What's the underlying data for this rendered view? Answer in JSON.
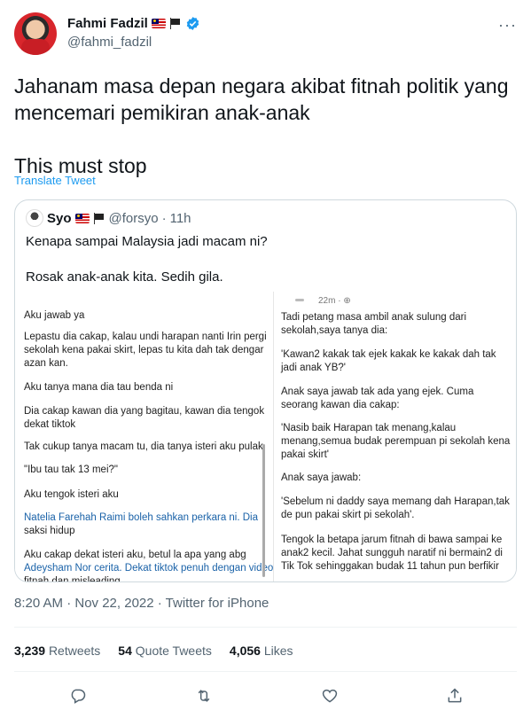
{
  "author": {
    "display_name": "Fahmi Fadzil",
    "handle": "@fahmi_fadzil"
  },
  "tweet": {
    "text": "Jahanam masa depan negara akibat fitnah politik yang mencemari pemikiran anak-anak\n\nThis must stop",
    "translate_label": "Translate Tweet",
    "timestamp": "8:20 AM · Nov 22, 2022 · Twitter for iPhone"
  },
  "quote": {
    "display_name": "Syo",
    "handle": "@forsyo",
    "time": "11h",
    "text": "Kenapa sampai Malaysia jadi macam ni?\n\nRosak anak-anak kita. Sedih gila.",
    "image_left_lines": [
      "Aku jawab ya",
      "Lepastu dia cakap, kalau undi harapan nanti Irin pergi",
      "sekolah kena pakai skirt, lepas tu kita dah tak dengar",
      "azan kan.",
      "Aku tanya mana dia tau benda ni",
      "Dia cakap kawan dia yang bagitau, kawan dia tengok",
      "dekat tiktok",
      "Tak cukup tanya macam tu, dia tanya isteri aku pulak",
      "\"Ibu tau tak 13 mei?\"",
      "Aku tengok isteri aku",
      "Natelia Farehah Raimi boleh sahkan perkara ni. Dia",
      "saksi hidup",
      "Aku cakap dekat isteri aku, betul la apa yang abg",
      "Adeysham Nor cerita. Dekat tiktok penuh dengan video",
      "fitnah dan misleading"
    ],
    "image_right_time": "22m · ⊕",
    "image_right_lines": [
      "Tadi petang masa ambil anak sulung dari",
      "sekolah,saya tanya dia:",
      "'Kawan2 kakak tak ejek kakak ke kakak dah tak",
      "jadi anak YB?'",
      "Anak saya jawab tak ada yang ejek. Cuma",
      "seorang kawan dia cakap:",
      "'Nasib baik Harapan tak menang,kalau",
      "menang,semua budak perempuan pi sekolah kena",
      "pakai skirt'",
      "Anak saya jawab:",
      "'Sebelum ni daddy saya memang dah Harapan,tak",
      "de pun pakai skirt pi sekolah'.",
      "Tengok la betapa jarum fitnah di bawa sampai ke",
      "anak2 kecil. Jahat sungguh naratif ni bermain2 di",
      "Tik Tok sehinggakan budak 11 tahun pun berfikir"
    ]
  },
  "stats": {
    "retweets_count": "3,239",
    "retweets_label": "Retweets",
    "quotes_count": "54",
    "quotes_label": "Quote Tweets",
    "likes_count": "4,056",
    "likes_label": "Likes"
  },
  "icons": [
    "more-icon",
    "verified-icon",
    "reply-icon",
    "retweet-icon",
    "like-icon",
    "share-icon"
  ],
  "colors": {
    "link": "#1d9bf0",
    "muted": "#536471",
    "text": "#0f1419",
    "border": "#cfd9de"
  }
}
